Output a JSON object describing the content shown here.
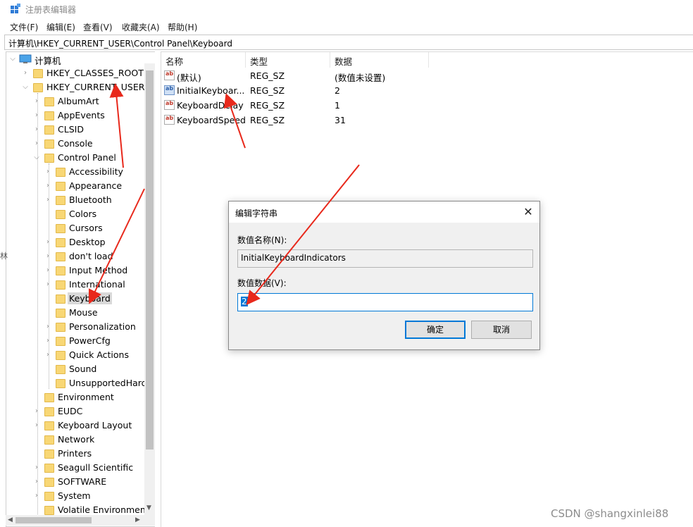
{
  "window": {
    "title": "注册表编辑器"
  },
  "menu": [
    "文件(F)",
    "编辑(E)",
    "查看(V)",
    "收藏夹(A)",
    "帮助(H)"
  ],
  "address": "计算机\\HKEY_CURRENT_USER\\Control Panel\\Keyboard",
  "tree": {
    "root": "计算机",
    "hives": [
      "HKEY_CLASSES_ROOT",
      "HKEY_CURRENT_USER"
    ],
    "hkcu_children_top": [
      "AlbumArt",
      "AppEvents",
      "CLSID",
      "Console",
      "Control Panel"
    ],
    "control_panel_children": [
      "Accessibility",
      "Appearance",
      "Bluetooth",
      "Colors",
      "Cursors",
      "Desktop",
      "don't load",
      "Input Method",
      "International",
      "Keyboard",
      "Mouse",
      "Personalization",
      "PowerCfg",
      "Quick Actions",
      "Sound",
      "UnsupportedHardw"
    ],
    "hkcu_children_bottom": [
      "Environment",
      "EUDC",
      "Keyboard Layout",
      "Network",
      "Printers",
      "Seagull Scientific",
      "SOFTWARE",
      "System",
      "Volatile Environment"
    ],
    "selected": "Keyboard"
  },
  "list": {
    "headers": [
      "名称",
      "类型",
      "数据"
    ],
    "rows": [
      {
        "name": "(默认)",
        "type": "REG_SZ",
        "data": "(数值未设置)"
      },
      {
        "name": "InitialKeyboar...",
        "type": "REG_SZ",
        "data": "2"
      },
      {
        "name": "KeyboardDelay",
        "type": "REG_SZ",
        "data": "1"
      },
      {
        "name": "KeyboardSpeed",
        "type": "REG_SZ",
        "data": "31"
      }
    ]
  },
  "dialog": {
    "title": "编辑字符串",
    "name_label": "数值名称(N):",
    "name_value": "InitialKeyboardIndicators",
    "data_label": "数值数据(V):",
    "data_value": "2",
    "ok_label": "确定",
    "cancel_label": "取消",
    "close_glyph": "✕"
  },
  "watermark": "CSDN @shangxinlei88",
  "side_clip": "林",
  "colors": {
    "accent": "#0078d7",
    "folder": "#f8d775",
    "annotation": "#e8291c"
  }
}
